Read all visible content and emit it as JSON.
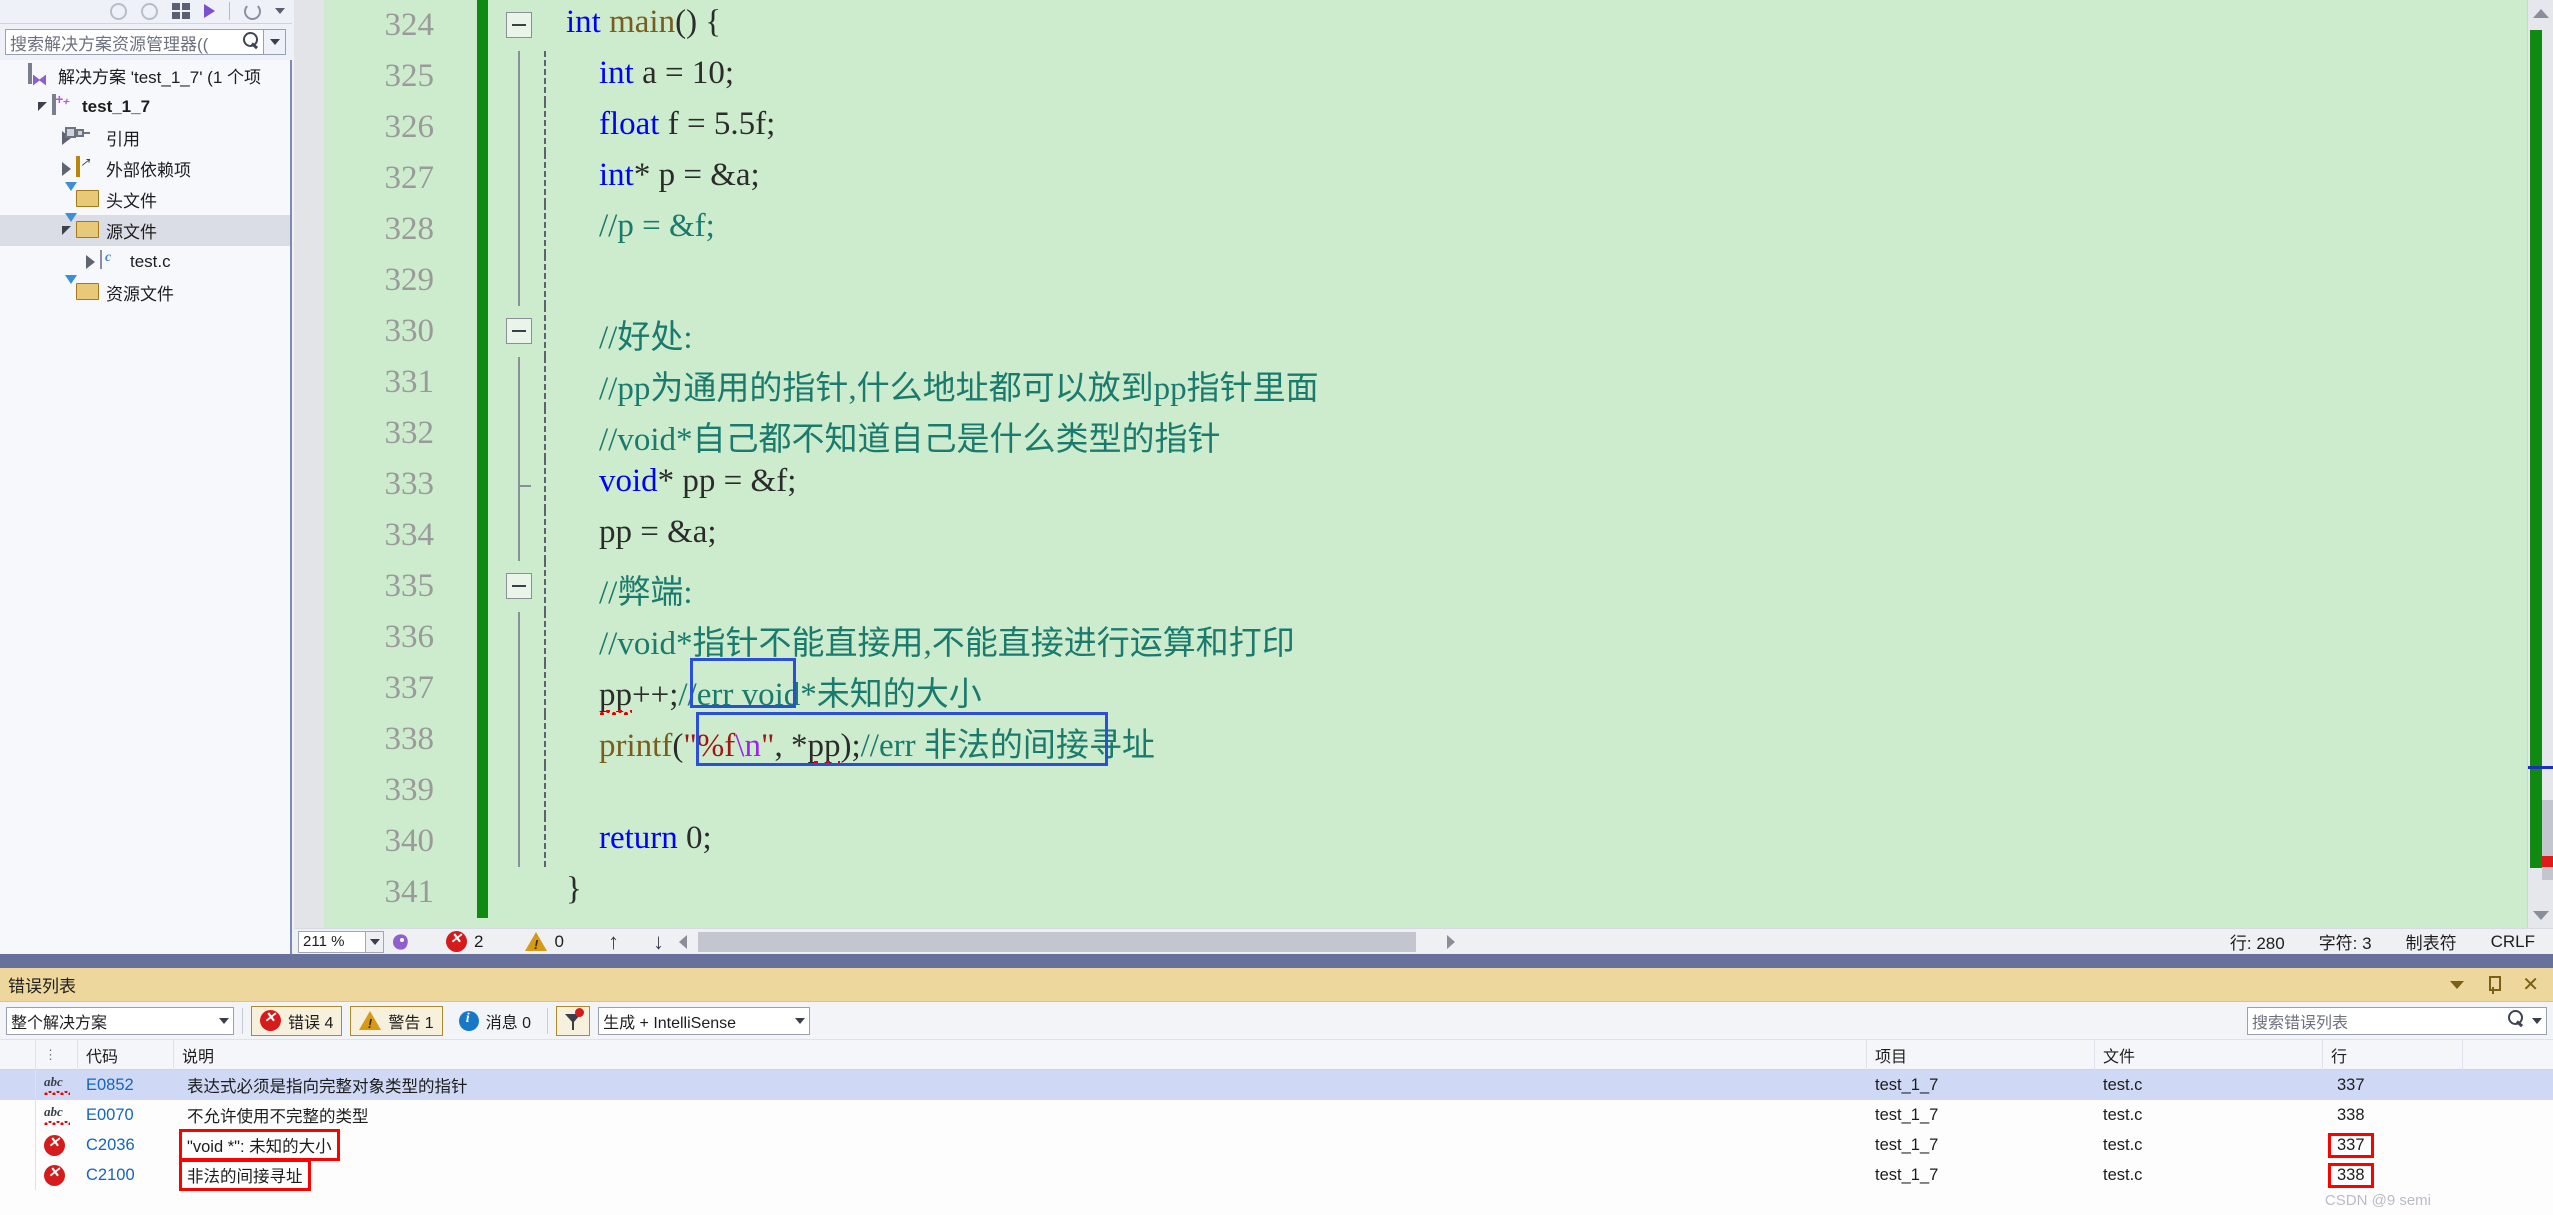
{
  "solution_explorer": {
    "search_placeholder": "搜索解决方案资源管理器((",
    "search_icon": "search-icon",
    "tree": [
      {
        "label": "解决方案 'test_1_7' (1 个项",
        "icon": "solution-icon",
        "indent": 0,
        "twisty": "none",
        "bold": false
      },
      {
        "label": "test_1_7",
        "icon": "project-icon",
        "indent": 1,
        "twisty": "down",
        "bold": true
      },
      {
        "label": "引用",
        "icon": "references-icon",
        "indent": 2,
        "twisty": "right",
        "bold": false
      },
      {
        "label": "外部依赖项",
        "icon": "external-deps-icon",
        "indent": 2,
        "twisty": "right",
        "bold": false
      },
      {
        "label": "头文件",
        "icon": "filter-folder-icon",
        "indent": 2,
        "twisty": "none",
        "bold": false
      },
      {
        "label": "源文件",
        "icon": "filter-folder-icon",
        "indent": 2,
        "twisty": "down",
        "bold": false,
        "selected": true
      },
      {
        "label": "test.c",
        "icon": "c-file-icon",
        "indent": 3,
        "twisty": "right",
        "bold": false
      },
      {
        "label": "资源文件",
        "icon": "filter-folder-icon",
        "indent": 2,
        "twisty": "none",
        "bold": false
      }
    ]
  },
  "editor": {
    "lines": [
      {
        "num": "324",
        "outline": "minus",
        "guide": "none",
        "tokens": [
          {
            "t": "int ",
            "c": "kw"
          },
          {
            "t": "main",
            "c": "fn"
          },
          {
            "t": "() {",
            "c": "pl"
          }
        ]
      },
      {
        "num": "325",
        "outline": "none",
        "guide": "dash",
        "tokens": [
          {
            "t": "    ",
            "c": "pl"
          },
          {
            "t": "int",
            "c": "kw"
          },
          {
            "t": " a = ",
            "c": "pl"
          },
          {
            "t": "10",
            "c": "pl"
          },
          {
            "t": ";",
            "c": "pl"
          }
        ]
      },
      {
        "num": "326",
        "outline": "none",
        "guide": "dash",
        "tokens": [
          {
            "t": "    ",
            "c": "pl"
          },
          {
            "t": "float",
            "c": "kw"
          },
          {
            "t": " f = ",
            "c": "pl"
          },
          {
            "t": "5.5f",
            "c": "pl"
          },
          {
            "t": ";",
            "c": "pl"
          }
        ]
      },
      {
        "num": "327",
        "outline": "none",
        "guide": "dash",
        "tokens": [
          {
            "t": "    ",
            "c": "pl"
          },
          {
            "t": "int",
            "c": "kw"
          },
          {
            "t": "* p = &a;",
            "c": "pl"
          }
        ]
      },
      {
        "num": "328",
        "outline": "none",
        "guide": "dash",
        "tokens": [
          {
            "t": "    //p = &f;",
            "c": "cm"
          }
        ]
      },
      {
        "num": "329",
        "outline": "none",
        "guide": "dash",
        "tokens": []
      },
      {
        "num": "330",
        "outline": "minus",
        "guide": "dash",
        "tokens": [
          {
            "t": "    //好处:",
            "c": "cm"
          }
        ]
      },
      {
        "num": "331",
        "outline": "none",
        "guide": "dash",
        "tokens": [
          {
            "t": "    //pp为通用的指针,什么地址都可以放到pp指针里面",
            "c": "cm"
          }
        ]
      },
      {
        "num": "332",
        "outline": "none",
        "guide": "dash",
        "tokens": [
          {
            "t": "    //void*自己都不知道自己是什么类型的指针",
            "c": "cm"
          }
        ]
      },
      {
        "num": "333",
        "outline": "none",
        "guide": "dash-end",
        "tokens": [
          {
            "t": "    ",
            "c": "pl"
          },
          {
            "t": "void",
            "c": "kw"
          },
          {
            "t": "* pp = &f;",
            "c": "pl"
          }
        ]
      },
      {
        "num": "334",
        "outline": "none",
        "guide": "dash",
        "tokens": [
          {
            "t": "    pp = &a;",
            "c": "pl"
          }
        ]
      },
      {
        "num": "335",
        "outline": "minus",
        "guide": "dash",
        "tokens": [
          {
            "t": "    //弊端:",
            "c": "cm"
          }
        ]
      },
      {
        "num": "336",
        "outline": "none",
        "guide": "dash",
        "tokens": [
          {
            "t": "    //void*指针不能直接用,不能直接进行运算和打印",
            "c": "cm"
          }
        ]
      },
      {
        "num": "337",
        "outline": "none",
        "guide": "dash",
        "tokens": [
          {
            "t": "    ",
            "c": "pl"
          },
          {
            "t": "pp",
            "c": "pl",
            "squiggle": true
          },
          {
            "t": "++;",
            "c": "pl"
          },
          {
            "t": "//err void*未知的大小",
            "c": "cm"
          }
        ]
      },
      {
        "num": "338",
        "outline": "none",
        "guide": "dash",
        "tokens": [
          {
            "t": "    ",
            "c": "pl"
          },
          {
            "t": "printf",
            "c": "fn"
          },
          {
            "t": "(",
            "c": "pl"
          },
          {
            "t": "\"%f",
            "c": "st"
          },
          {
            "t": "\\n",
            "c": "esc"
          },
          {
            "t": "\"",
            "c": "st"
          },
          {
            "t": ", *",
            "c": "pl"
          },
          {
            "t": "pp",
            "c": "pl",
            "squiggle": true
          },
          {
            "t": ")",
            "c": "pl"
          },
          {
            "t": ";",
            "c": "pl"
          },
          {
            "t": "//err 非法的间接寻址",
            "c": "cm"
          }
        ]
      },
      {
        "num": "339",
        "outline": "none",
        "guide": "dash",
        "tokens": []
      },
      {
        "num": "340",
        "outline": "none",
        "guide": "dash",
        "tokens": [
          {
            "t": "    ",
            "c": "pl"
          },
          {
            "t": "return",
            "c": "kw"
          },
          {
            "t": " 0;",
            "c": "pl"
          }
        ]
      },
      {
        "num": "341",
        "outline": "none",
        "guide": "none",
        "tokens": [
          {
            "t": "}",
            "c": "pl"
          }
        ]
      }
    ],
    "status": {
      "zoom": "211 %",
      "error_count": "2",
      "warning_count": "0",
      "line_label": "行: 280",
      "char_label": "字符: 3",
      "tabs_label": "制表符",
      "eol_label": "CRLF"
    }
  },
  "error_list": {
    "title": "错误列表",
    "scope_filter": "整个解决方案",
    "errors_label": "错误 4",
    "warnings_label": "警告 1",
    "messages_label": "消息 0",
    "build_filter": "生成 + IntelliSense",
    "search_placeholder": "搜索错误列表",
    "columns": [
      "",
      "",
      "代码",
      "说明",
      "项目",
      "文件",
      "行"
    ],
    "rows": [
      {
        "icon": "intellisense-icon",
        "code": "E0852",
        "description": "表达式必须是指向完整对象类型的指针",
        "project": "test_1_7",
        "file": "test.c",
        "line": "337",
        "selected": true,
        "desc_boxed": false,
        "line_boxed": false
      },
      {
        "icon": "intellisense-icon",
        "code": "E0070",
        "description": "不允许使用不完整的类型",
        "project": "test_1_7",
        "file": "test.c",
        "line": "338",
        "selected": false,
        "desc_boxed": false,
        "line_boxed": false
      },
      {
        "icon": "error-icon",
        "code": "C2036",
        "description": "\"void *\": 未知的大小",
        "project": "test_1_7",
        "file": "test.c",
        "line": "337",
        "selected": false,
        "desc_boxed": true,
        "line_boxed": true
      },
      {
        "icon": "error-icon",
        "code": "C2100",
        "description": "非法的间接寻址",
        "project": "test_1_7",
        "file": "test.c",
        "line": "338",
        "selected": false,
        "desc_boxed": true,
        "line_boxed": true
      }
    ],
    "watermark": "CSDN @9 semi"
  }
}
